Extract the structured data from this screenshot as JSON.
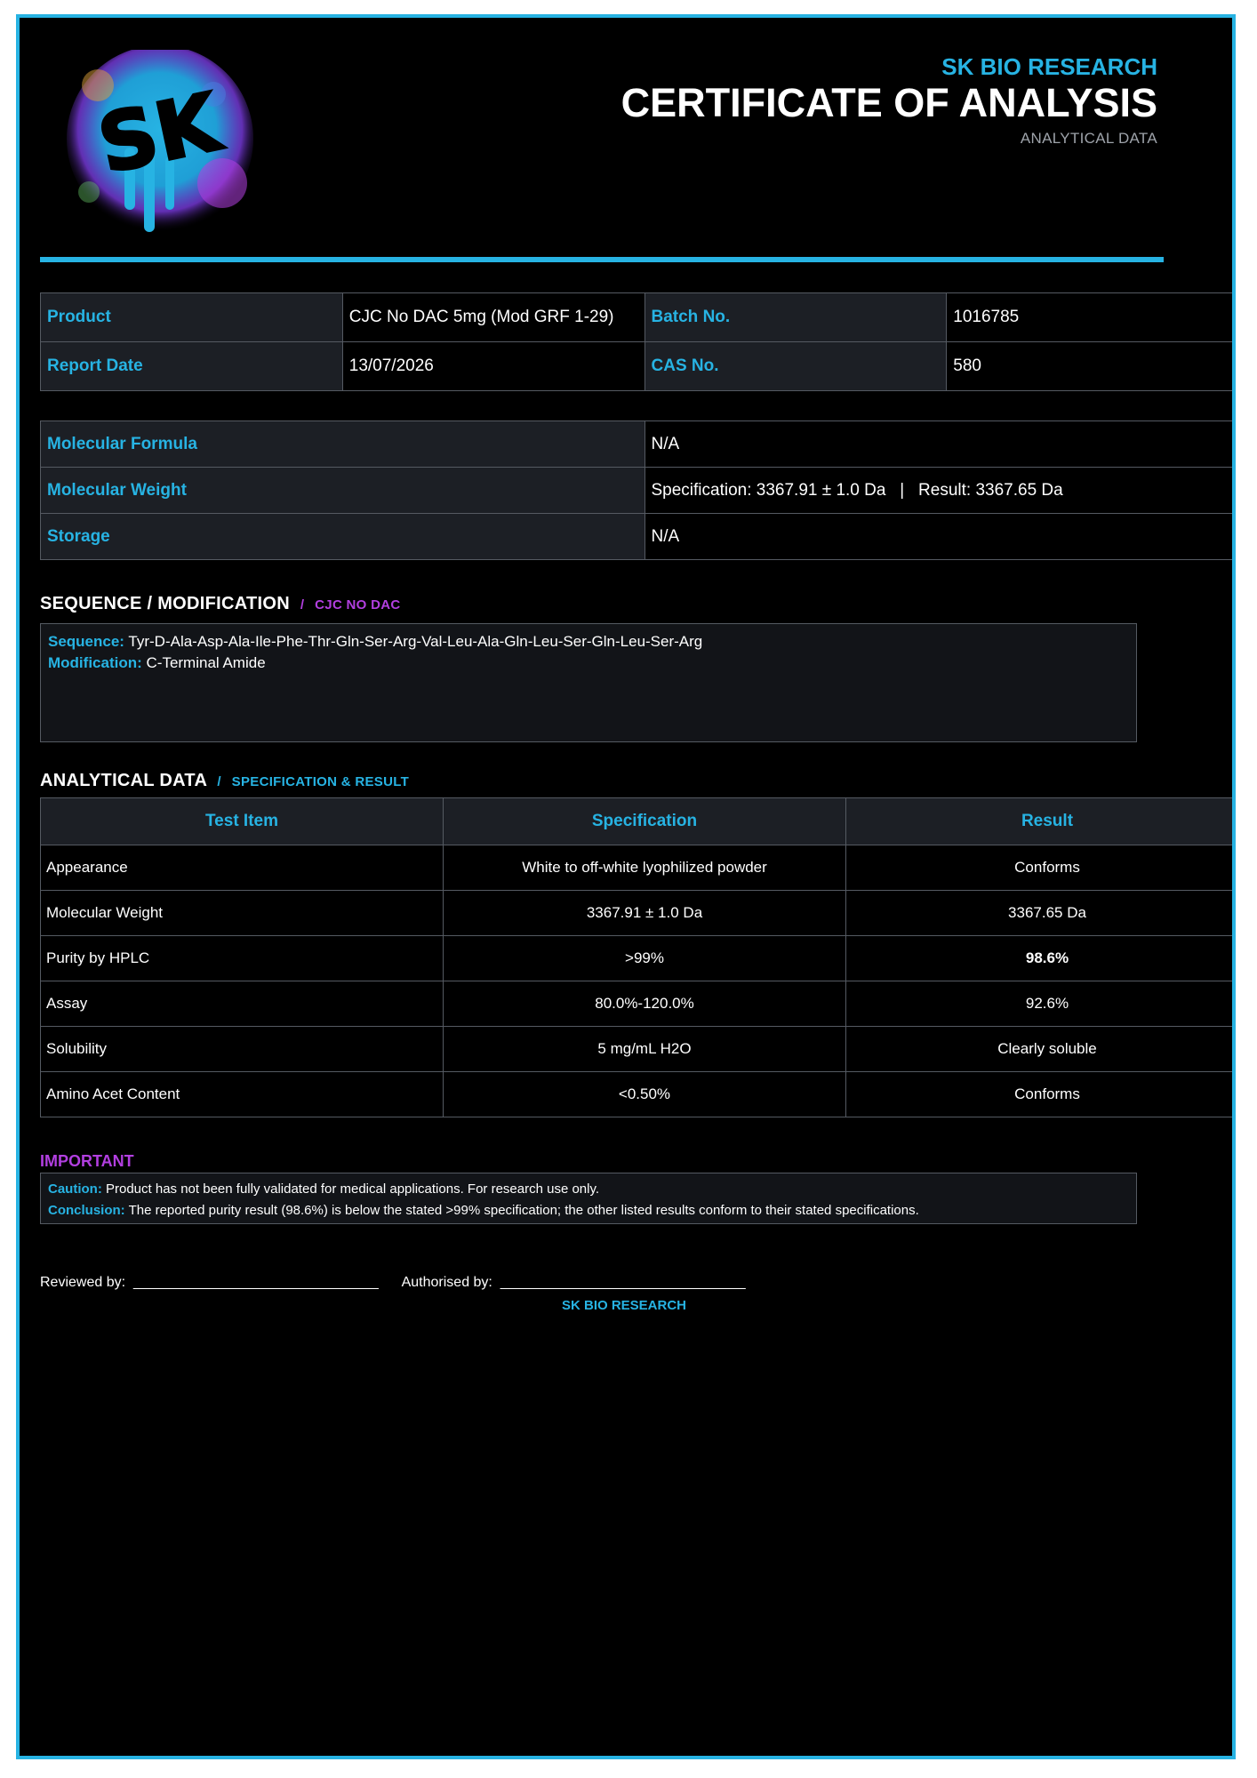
{
  "header": {
    "brand": "SK BIO RESEARCH",
    "title": "CERTIFICATE OF ANALYSIS",
    "subtitle": "ANALYTICAL DATA",
    "logo_text": "SK"
  },
  "info": {
    "product_label": "Product",
    "product_value": "CJC No DAC 5mg (Mod GRF 1-29)",
    "batch_label": "Batch No.",
    "batch_value": "1016785",
    "report_date_label": "Report Date",
    "report_date_value": "13/07/2026",
    "cas_label": "CAS No.",
    "cas_value": "580"
  },
  "properties": [
    {
      "label": "Molecular Formula",
      "value": "N/A"
    },
    {
      "label": "Molecular Weight",
      "value": "Specification: 3367.91 ± 1.0 Da   |   Result: 3367.65 Da"
    },
    {
      "label": "Storage",
      "value": "N/A"
    }
  ],
  "sequence": {
    "heading": "SEQUENCE / MODIFICATION",
    "sep": "/",
    "tag": "CJC NO DAC",
    "sequence_label": "Sequence:",
    "sequence_value": "Tyr-D-Ala-Asp-Ala-Ile-Phe-Thr-Gln-Ser-Arg-Val-Leu-Ala-Gln-Leu-Ser-Gln-Leu-Ser-Arg",
    "modification_label": "Modification:",
    "modification_value": "C-Terminal Amide"
  },
  "analytical": {
    "heading": "ANALYTICAL DATA",
    "sep": "/",
    "tag": "SPECIFICATION & RESULT",
    "columns": [
      "Test Item",
      "Specification",
      "Result"
    ],
    "rows": [
      {
        "item": "Appearance",
        "spec": "White to off-white lyophilized powder",
        "result": "Conforms"
      },
      {
        "item": "Molecular Weight",
        "spec": "3367.91 ± 1.0 Da",
        "result": "3367.65 Da"
      },
      {
        "item": "Purity by HPLC",
        "spec": ">99%",
        "result": "98.6%"
      },
      {
        "item": "Assay",
        "spec": "80.0%-120.0%",
        "result": "92.6%"
      },
      {
        "item": "Solubility",
        "spec": "5 mg/mL H2O",
        "result": "Clearly soluble"
      },
      {
        "item": "Amino Acet Content",
        "spec": "<0.50%",
        "result": "Conforms"
      }
    ]
  },
  "important": {
    "heading": "IMPORTANT",
    "caution_label": "Caution:",
    "caution_text": "Product has not been fully validated for medical applications. For research use only.",
    "conclusion_label": "Conclusion:",
    "conclusion_text": "The reported purity result (98.6%) is below the stated >99% specification; the other listed results conform to their stated specifications."
  },
  "signatures": {
    "reviewed_label": "Reviewed by:",
    "authorised_label": "Authorised by:",
    "line": "_______________________________",
    "company": "SK BIO RESEARCH"
  },
  "colors": {
    "accent": "#27b3e3",
    "purple": "#b23fe0",
    "highlight": "#f0c36d",
    "background": "#000000"
  }
}
